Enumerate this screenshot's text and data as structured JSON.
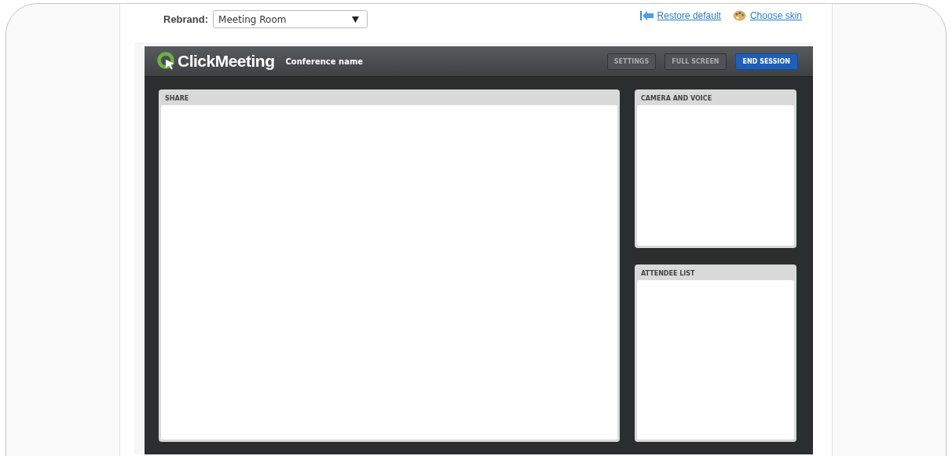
{
  "toolbar": {
    "rebrand_label": "Rebrand:",
    "rebrand_select": "Meeting Room",
    "links": [
      {
        "kind": "restore",
        "label": "Restore default"
      },
      {
        "kind": "skin",
        "label": "Choose skin"
      }
    ]
  },
  "app": {
    "logo": "ClickMeeting",
    "conference_name": "Conference name",
    "buttons": [
      {
        "label": "SETTINGS",
        "primary": false
      },
      {
        "label": "FULL SCREEN",
        "primary": false
      },
      {
        "label": "END SESSION",
        "primary": true
      }
    ],
    "panels": {
      "main": {
        "title": "SHARE"
      },
      "side": [
        {
          "title": "CAMERA AND VOICE"
        },
        {
          "title": "ATTENDEE LIST"
        }
      ]
    }
  }
}
